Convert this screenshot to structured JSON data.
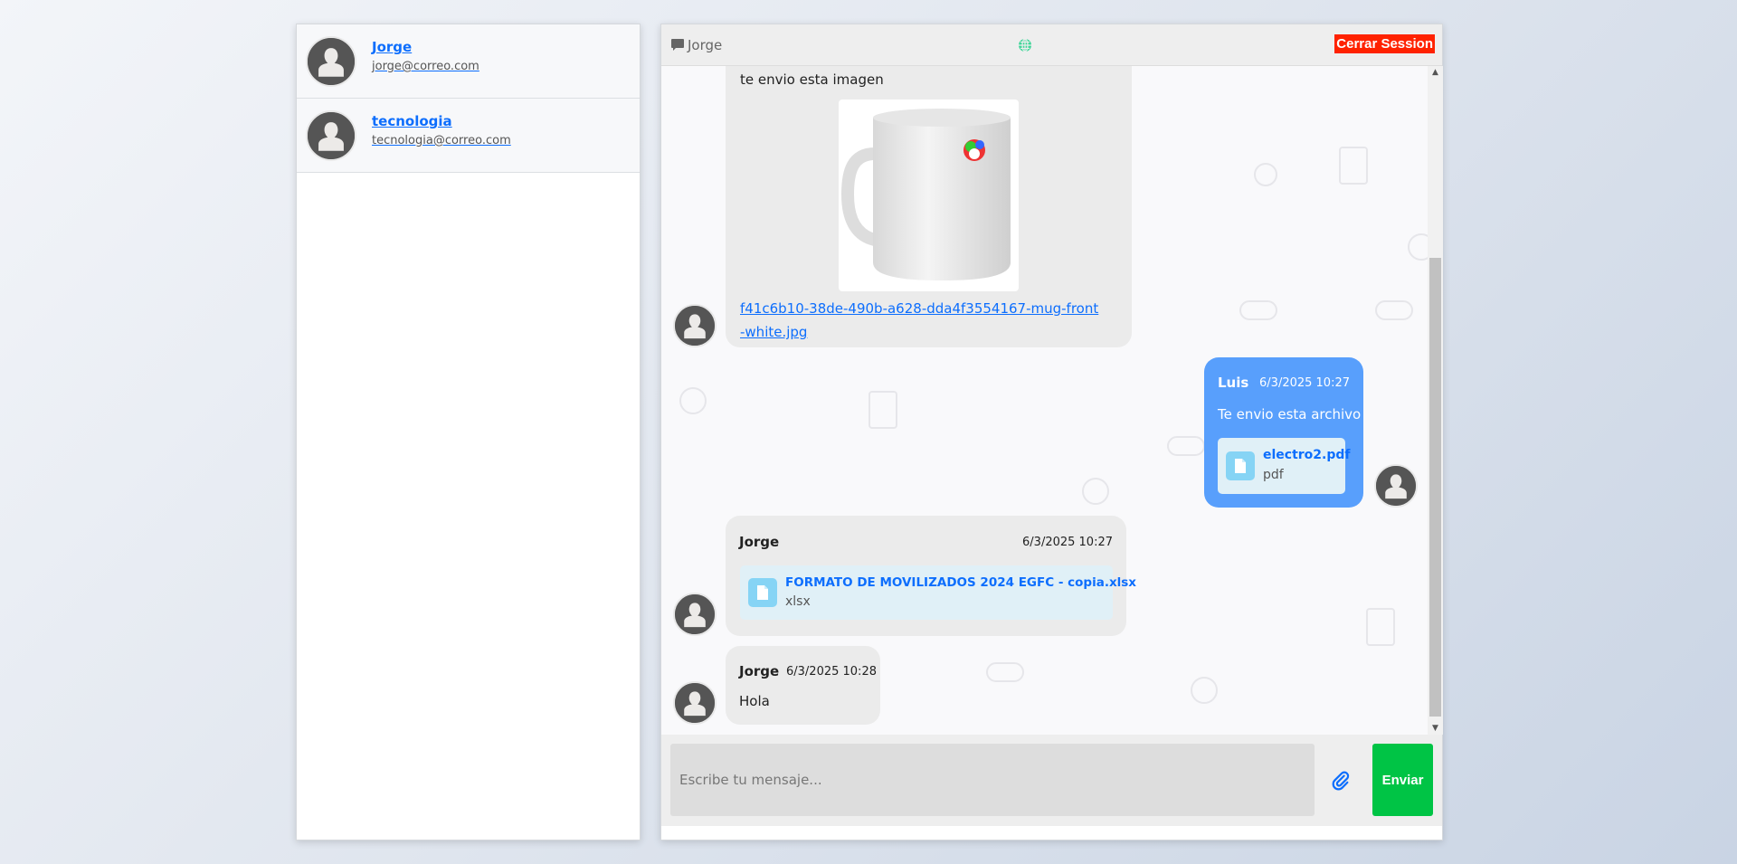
{
  "contacts": [
    {
      "name": "Jorge",
      "email": "jorge@correo.com"
    },
    {
      "name": "tecnologia",
      "email": "tecnologia@correo.com"
    }
  ],
  "header": {
    "chat_name": "Jorge",
    "logout_label": "Cerrar Session",
    "icons": [
      "chat-bubble-icon",
      "globe-icon"
    ],
    "globe_color": "#3ed598",
    "logout_color": "#ff2200"
  },
  "messages": [
    {
      "text": "te envio esta imagen",
      "image_alt": "mug",
      "link": "f41c6b10-38de-490b-a628-dda4f3554167-mug-front-white.jpg"
    },
    {
      "sender": "Luis",
      "time": "6/3/2025 10:27",
      "text": "Te envio esta archivo",
      "file": {
        "name": "electro2.pdf",
        "type": "pdf"
      }
    },
    {
      "sender": "Jorge",
      "time": "6/3/2025 10:27",
      "file": {
        "name": "FORMATO DE MOVILIZADOS 2024 EGFC - copia.xlsx",
        "type": "xlsx"
      }
    },
    {
      "sender": "Jorge",
      "time": "6/3/2025 10:28",
      "text": "Hola"
    }
  ],
  "composer": {
    "placeholder": "Escribe tu mensaje...",
    "value": "",
    "send_label": "Enviar",
    "send_color": "#00c445"
  }
}
